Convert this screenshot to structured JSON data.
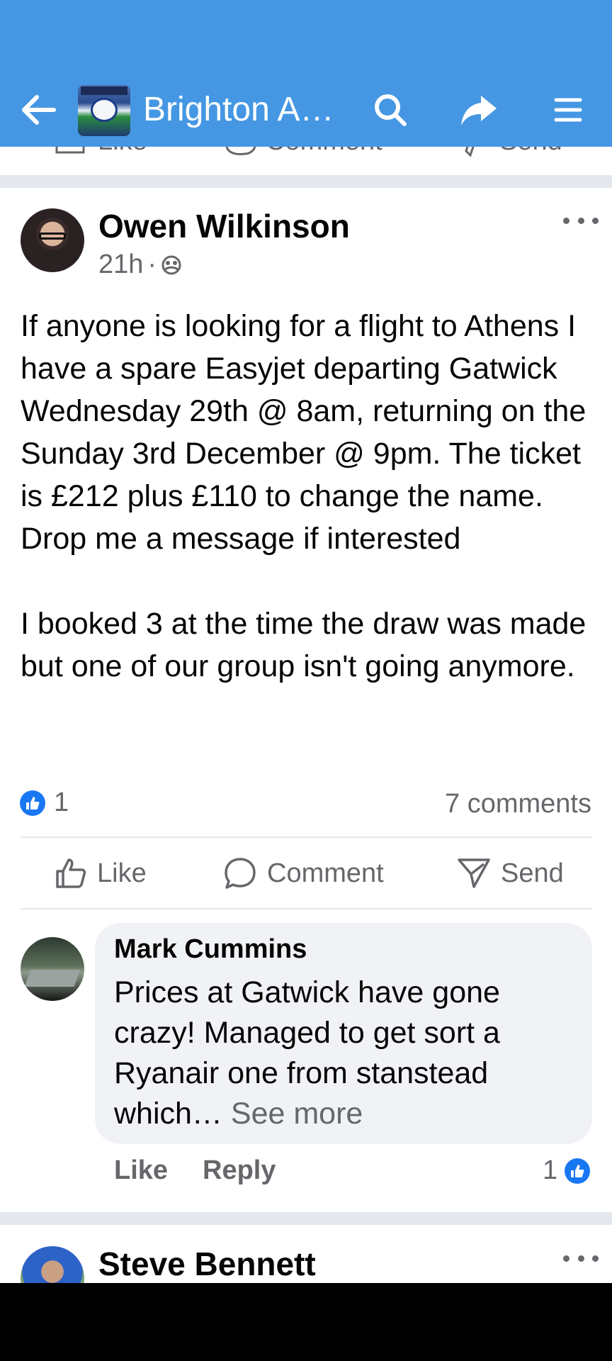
{
  "header": {
    "group_name": "Brighton A…",
    "colors": {
      "bar": "#4597E3",
      "text": "#ffffff"
    },
    "icons": [
      "back-arrow-icon",
      "search-icon",
      "share-icon",
      "menu-icon"
    ]
  },
  "previous_post_actions": {
    "like": "Like",
    "comment": "Comment",
    "send": "Send"
  },
  "post": {
    "author": "Owen Wilkinson",
    "time": "21h",
    "separator": "·",
    "audience_icon": "group-members-icon",
    "body": "If anyone is looking for a flight to Athens I have a spare Easyjet departing Gatwick Wednesday 29th @ 8am, returning on the Sunday 3rd December @ 9pm. The ticket is £212 plus £110 to change the name. Drop me a message if interested\n\nI booked 3 at the time the draw was made but one of our group isn't going anymore.",
    "reaction_count": "1",
    "comments_count": "7 comments",
    "actions": {
      "like": "Like",
      "comment": "Comment",
      "send": "Send"
    }
  },
  "comment": {
    "author": "Mark Cummins",
    "text": "Prices at Gatwick have gone crazy! Managed to get sort a Ryanair one from stanstead which…",
    "see_more": " See more",
    "like_label": "Like",
    "reply_label": "Reply",
    "reaction_count": "1"
  },
  "next_post": {
    "author": "Steve Bennett"
  },
  "colors": {
    "accent": "#1877F2",
    "secondary_text": "#65676B",
    "separator": "#E4E8ED",
    "bubble": "#F0F2F5"
  }
}
